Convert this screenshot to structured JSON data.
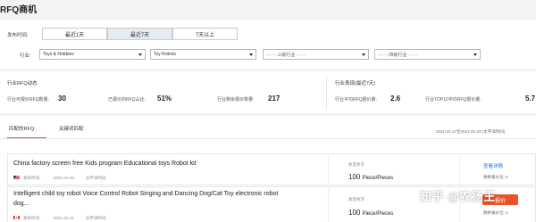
{
  "page_title": "RFQ商机",
  "filters": {
    "time_label": "发布时间:",
    "time_tabs": [
      "最近1天",
      "最近7天",
      "7天以上"
    ],
    "industry_label": "行业:",
    "industry_level1": "Toys & Hobbies",
    "industry_level2": "Toy Robots",
    "industry_level3": "- - - - 三级行业 - - - -",
    "industry_level4": "- - - - 四级行业 - - - -"
  },
  "rfq_dynamics": {
    "title": "行业RFQ动态",
    "quotable_label": "行业可报价RFQ数量:",
    "quotable_value": "30",
    "quoted_pct_label": "已报价的RFQ占比:",
    "quoted_pct_value": "51%",
    "remaining_label": "行业剩余报价数量:",
    "remaining_value": "217"
  },
  "industry_perf": {
    "title": "行业表现(最近7天)",
    "avg_label": "行业平均RFQ报价量:",
    "avg_value": "2.6",
    "top10_label": "行业TOP10平均RFQ报价量:",
    "top10_value": "5.7"
  },
  "tabs": [
    "匹配的RFQ",
    "关键词匹配"
  ],
  "date_range": "2021-01-17至2021-01-23 (太平洋时间)",
  "rfq_rows": [
    {
      "title": "China factory screen free Kids program Educational toys Robot kit",
      "posted": "发布时间:",
      "date": "2021-01-20",
      "tz": "太平洋时间",
      "qty_label": "数量要求",
      "qty_value": "100",
      "qty_unit": "Piece/Pieces",
      "action": "查看详情",
      "remaining_label": "剩余报价位:",
      "remaining_value": "5"
    },
    {
      "title": "Intelligent child toy robot Voice Control Robot Singing and Dancing Dog/Cat Toy electronic robot",
      "title2": "dog...",
      "posted": "发布时间:",
      "date": "2021-01-21",
      "tz": "太平洋时间",
      "qty_label": "数量要求",
      "qty_value": "100",
      "qty_unit": "Piece/Pieces",
      "action": "报价",
      "remaining_label": "剩余报价位:",
      "remaining_value": "5"
    }
  ],
  "watermark": "知乎 @农扬王"
}
